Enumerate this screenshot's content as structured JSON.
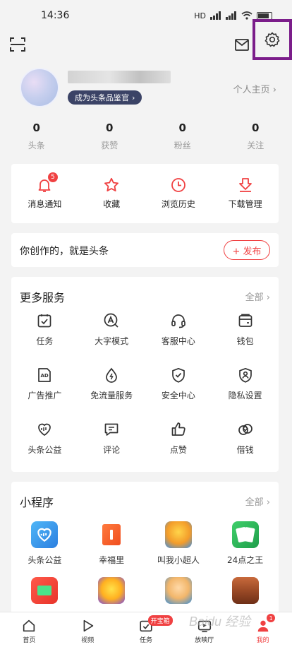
{
  "status_bar": {
    "time": "14:36",
    "signal_text": "HD"
  },
  "profile": {
    "badge_label": "成为头条品鉴官",
    "homepage_link": "个人主页 ›"
  },
  "stats": [
    {
      "value": "0",
      "label": "头条"
    },
    {
      "value": "0",
      "label": "获赞"
    },
    {
      "value": "0",
      "label": "粉丝"
    },
    {
      "value": "0",
      "label": "关注"
    }
  ],
  "quick_actions": [
    {
      "label": "消息通知",
      "badge": "5"
    },
    {
      "label": "收藏"
    },
    {
      "label": "浏览历史"
    },
    {
      "label": "下载管理"
    }
  ],
  "create": {
    "prompt": "你创作的，就是头条",
    "publish_label": "+ 发布"
  },
  "services": {
    "title": "更多服务",
    "all_label": "全部 ›",
    "items": [
      "任务",
      "大字模式",
      "客服中心",
      "钱包",
      "广告推广",
      "免流量服务",
      "安全中心",
      "隐私设置",
      "头条公益",
      "评论",
      "点赞",
      "借钱"
    ]
  },
  "mini_programs": {
    "title": "小程序",
    "all_label": "全部 ›",
    "items": [
      "头条公益",
      "幸福里",
      "叫我小超人",
      "24点之王",
      "",
      "",
      "",
      ""
    ]
  },
  "tabbar": {
    "tabs": [
      {
        "label": "首页"
      },
      {
        "label": "视频"
      },
      {
        "label": "任务",
        "badge": "开宝箱"
      },
      {
        "label": "放映厅"
      },
      {
        "label": "我的",
        "badge": "1"
      }
    ]
  },
  "watermark": "Baidu 经验",
  "colors": {
    "accent": "#f04142",
    "highlight_box": "#7b1d8a",
    "badge_bg": "#3b4366"
  }
}
